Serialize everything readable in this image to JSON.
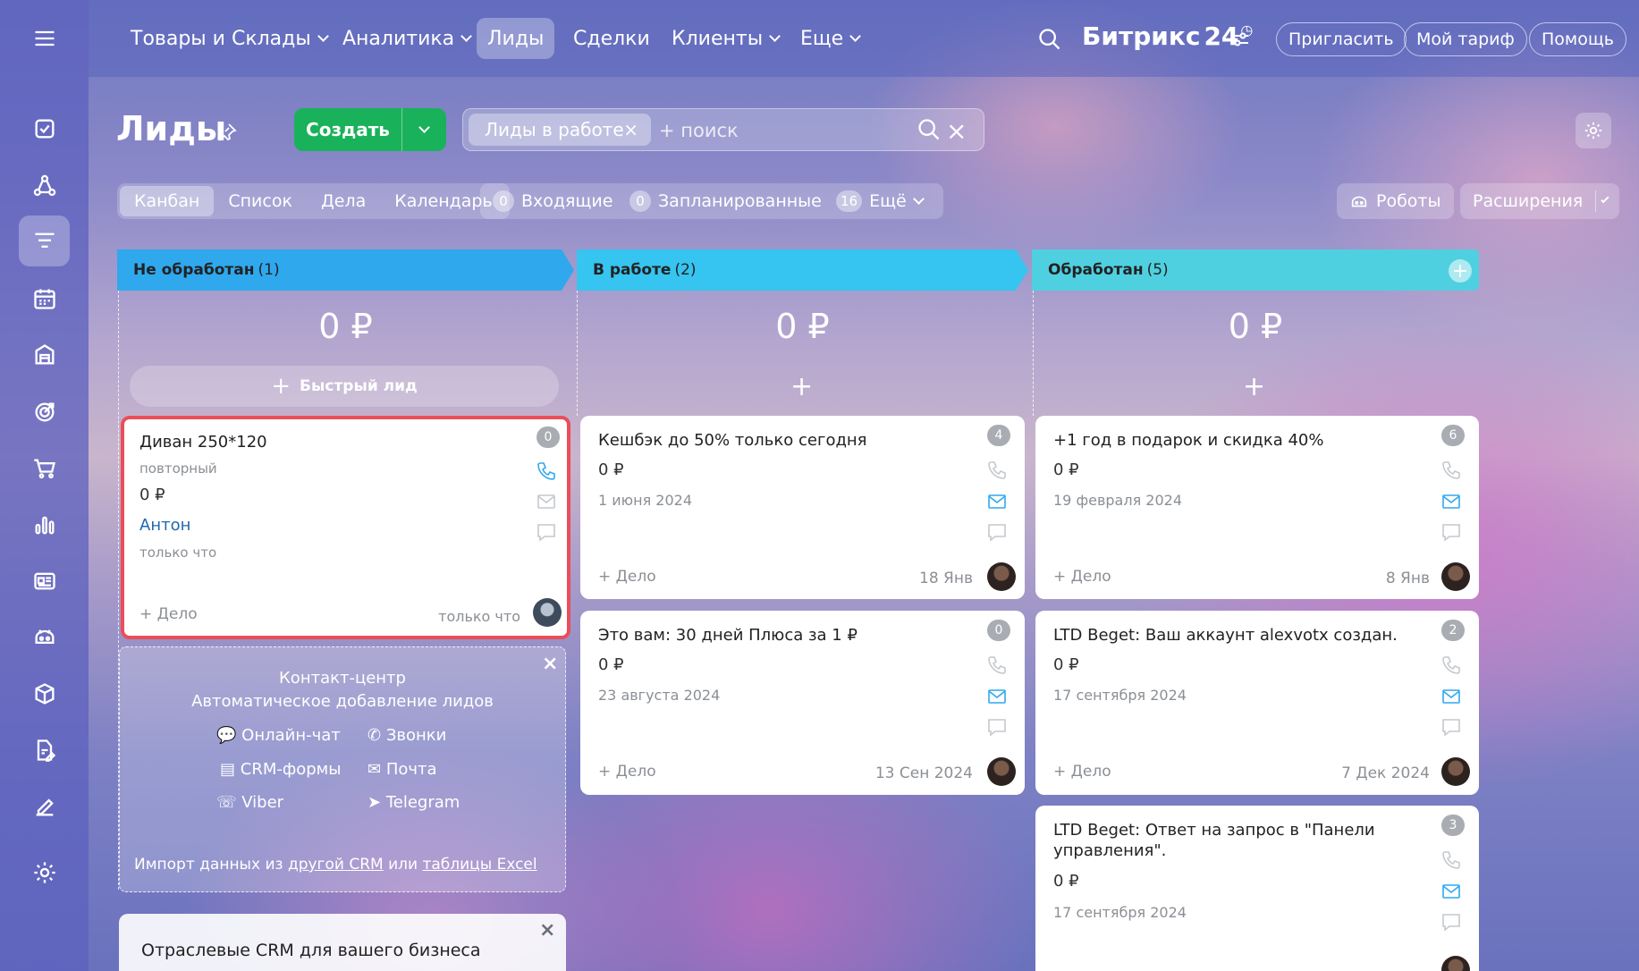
{
  "topnav": {
    "items": [
      {
        "label": "Товары и Склады",
        "dropdown": true
      },
      {
        "label": "Аналитика",
        "dropdown": true
      },
      {
        "label": "Лиды",
        "dropdown": false,
        "active": true
      },
      {
        "label": "Сделки",
        "dropdown": false
      },
      {
        "label": "Клиенты",
        "dropdown": true
      },
      {
        "label": "Еще",
        "dropdown": true
      }
    ],
    "brand": "Битрикс",
    "brand_num": "24",
    "invite": "Пригласить",
    "tariff": "Мой тариф",
    "help": "Помощь"
  },
  "page": {
    "title": "Лиды",
    "create": "Создать",
    "filter_chip": "Лиды в работе",
    "search_placeholder": "+ поиск"
  },
  "view_tabs": [
    "Канбан",
    "Список",
    "Дела",
    "Календарь"
  ],
  "counters": [
    {
      "count": "0",
      "label": "Входящие"
    },
    {
      "count": "0",
      "label": "Запланированные"
    },
    {
      "count": "16",
      "label": "Ещё"
    }
  ],
  "robots": "Роботы",
  "extensions": "Расширения",
  "columns": [
    {
      "title": "Не обработан",
      "count": "(1)",
      "sum": "0 ₽",
      "color": "#2fa8ee",
      "quick": "Быстрый лид"
    },
    {
      "title": "В работе",
      "count": "(2)",
      "sum": "0 ₽",
      "color": "#36c4f0",
      "quick": "+"
    },
    {
      "title": "Обработан",
      "count": "(5)",
      "sum": "0 ₽",
      "color": "#4fd0e0",
      "quick": "+"
    }
  ],
  "cards": {
    "c1": {
      "title": "Диван 250*120",
      "sub": "повторный",
      "money": "0 ₽",
      "contact": "Антон",
      "time": "только что",
      "badge": "0",
      "deal": "+ Дело",
      "when": "только что"
    },
    "c2": {
      "title": "Кешбэк до 50% только сегодня",
      "money": "0 ₽",
      "date": "1 июня 2024",
      "badge": "4",
      "deal": "+ Дело",
      "when": "18 Янв"
    },
    "c3": {
      "title": "Это вам: 30 дней Плюса за 1 ₽",
      "money": "0 ₽",
      "date": "23 августа 2024",
      "badge": "0",
      "deal": "+ Дело",
      "when": "13 Сен 2024"
    },
    "c4": {
      "title": "+1 год в подарок и скидка 40%",
      "money": "0 ₽",
      "date": "19 февраля 2024",
      "badge": "6",
      "deal": "+ Дело",
      "when": "8 Янв"
    },
    "c5": {
      "title": "LTD Beget: Ваш аккаунт alexvotx создан.",
      "money": "0 ₽",
      "date": "17 сентября 2024",
      "badge": "2",
      "deal": "+ Дело",
      "when": "7 Дек 2024"
    },
    "c6": {
      "title": "LTD Beget: Ответ на запрос в \"Панели управления\".",
      "money": "0 ₽",
      "date": "17 сентября 2024",
      "badge": "3"
    }
  },
  "promo": {
    "title1": "Контакт-центр",
    "title2": "Автоматическое добавление лидов",
    "chat": "Онлайн-чат",
    "calls": "Звонки",
    "forms": "CRM-формы",
    "mail": "Почта",
    "viber": "Viber",
    "telegram": "Telegram",
    "import_prefix": "Импорт данных из ",
    "import_link1": "другой CRM",
    "import_mid": " или ",
    "import_link2": "таблицы Excel"
  },
  "promo2": {
    "title": "Отраслевые CRM для вашего бизнеса"
  }
}
